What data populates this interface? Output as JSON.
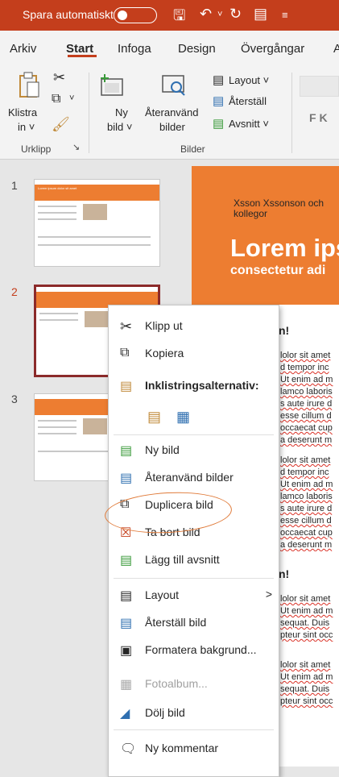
{
  "titlebar": {
    "autosave": "Spara automatiskt"
  },
  "tabs": [
    "Arkiv",
    "Start",
    "Infoga",
    "Design",
    "Övergångar",
    "A"
  ],
  "ribbon": {
    "paste_top": "Klistra",
    "paste_bottom": "in ˅",
    "new_slide_top": "Ny",
    "new_slide_bottom": "bild ˅",
    "reuse_top": "Återanvänd",
    "reuse_bottom": "bilder",
    "layout": "Layout ˅",
    "reset": "Återställ",
    "section": "Avsnitt ˅",
    "font_letters": "F  K",
    "group_clipboard": "Urklipp",
    "group_slides": "Bilder"
  },
  "thumbnails": [
    {
      "number": "1"
    },
    {
      "number": "2"
    },
    {
      "number": "3"
    }
  ],
  "thumb_texts": {
    "title": "Lorem ipsum dolor sit amet",
    "subtitle": "consectetur adipiscing elit sed do eiusmod tempor incididunt"
  },
  "slide": {
    "authors": "Xsson Xssonson och kollegor",
    "title": "Lorem ips",
    "subtitle": "consectetur adi",
    "heading1": "n!",
    "heading2": "n!",
    "lines1": [
      "lolor sit amet",
      "d tempor inc",
      "Ut enim ad m",
      "lamco laboris",
      "s aute irure d",
      "esse cillum d",
      "occaecat cup",
      "a deserunt m"
    ],
    "lines2": [
      "lolor sit amet",
      "d tempor inc",
      "Ut enim ad m",
      "lamco laboris",
      "s aute irure d",
      "esse cillum d",
      "occaecat cup",
      "a deserunt m"
    ],
    "lines3": [
      "lolor sit amet",
      "Ut enim ad m",
      "sequat. Duis",
      "pteur sint occ"
    ],
    "lines4": [
      "lolor sit amet",
      "Ut enim ad m",
      "sequat. Duis",
      "pteur sint occ"
    ]
  },
  "menu": {
    "cut": "Klipp ut",
    "copy": "Kopiera",
    "paste_options": "Inklistringsalternativ:",
    "new_slide": "Ny bild",
    "reuse": "Återanvänd bilder",
    "duplicate": "Duplicera bild",
    "delete": "Ta bort bild",
    "add_section": "Lägg till avsnitt",
    "layout": "Layout",
    "reset": "Återställ bild",
    "format_bg": "Formatera bakgrund...",
    "photo_album": "Fotoalbum...",
    "hide": "Dölj bild",
    "new_comment": "Ny kommentar",
    "submenu_arrow": ">"
  }
}
